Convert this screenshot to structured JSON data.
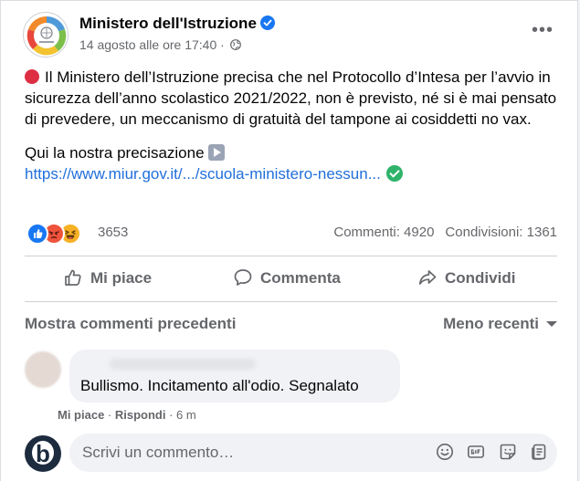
{
  "post": {
    "page_name": "Ministero dell'Istruzione",
    "timestamp": "14 agosto alle ore 17:40",
    "separator": " · ",
    "paragraph1": "Il Ministero dell’Istruzione precisa che nel Protocollo d’Intesa per l’avvio in sicurezza dell’anno scolastico 2021/2022,  non è previsto, né si è mai pensato di prevedere, un meccanismo di gratuità del tampone ai cosiddetti no vax.",
    "paragraph2": "Qui la nostra precisazione",
    "link": "https://www.miur.gov.it/.../scuola-ministero-nessun..."
  },
  "reactions": {
    "count": "3653",
    "comments": "Commenti: 4920",
    "shares": "Condivisioni: 1361"
  },
  "actions": {
    "like": "Mi piace",
    "comment": "Commenta",
    "share": "Condividi"
  },
  "comments_section": {
    "previous": "Mostra commenti precedenti",
    "sort": "Meno recenti"
  },
  "comment": {
    "text": "Bullismo. Incitamento all'odio. Segnalato",
    "like": "Mi piace",
    "reply": "Rispondi",
    "time": "6 m"
  },
  "composer": {
    "placeholder": "Scrivi un commento…",
    "avatar_letter": "b"
  },
  "icons": {
    "verified": "verified-badge-icon",
    "globe": "globe-icon",
    "more": "more-options-icon",
    "like": "thumbs-up-icon",
    "comment": "speech-bubble-icon",
    "share": "share-arrow-icon",
    "emoji": "emoji-icon",
    "gif": "gif-icon",
    "sticker": "sticker-icon",
    "avatar": "avatar-sticker-icon"
  },
  "colors": {
    "link": "#216fdb",
    "accent": "#1877f2",
    "secondary_text": "#65676b"
  }
}
